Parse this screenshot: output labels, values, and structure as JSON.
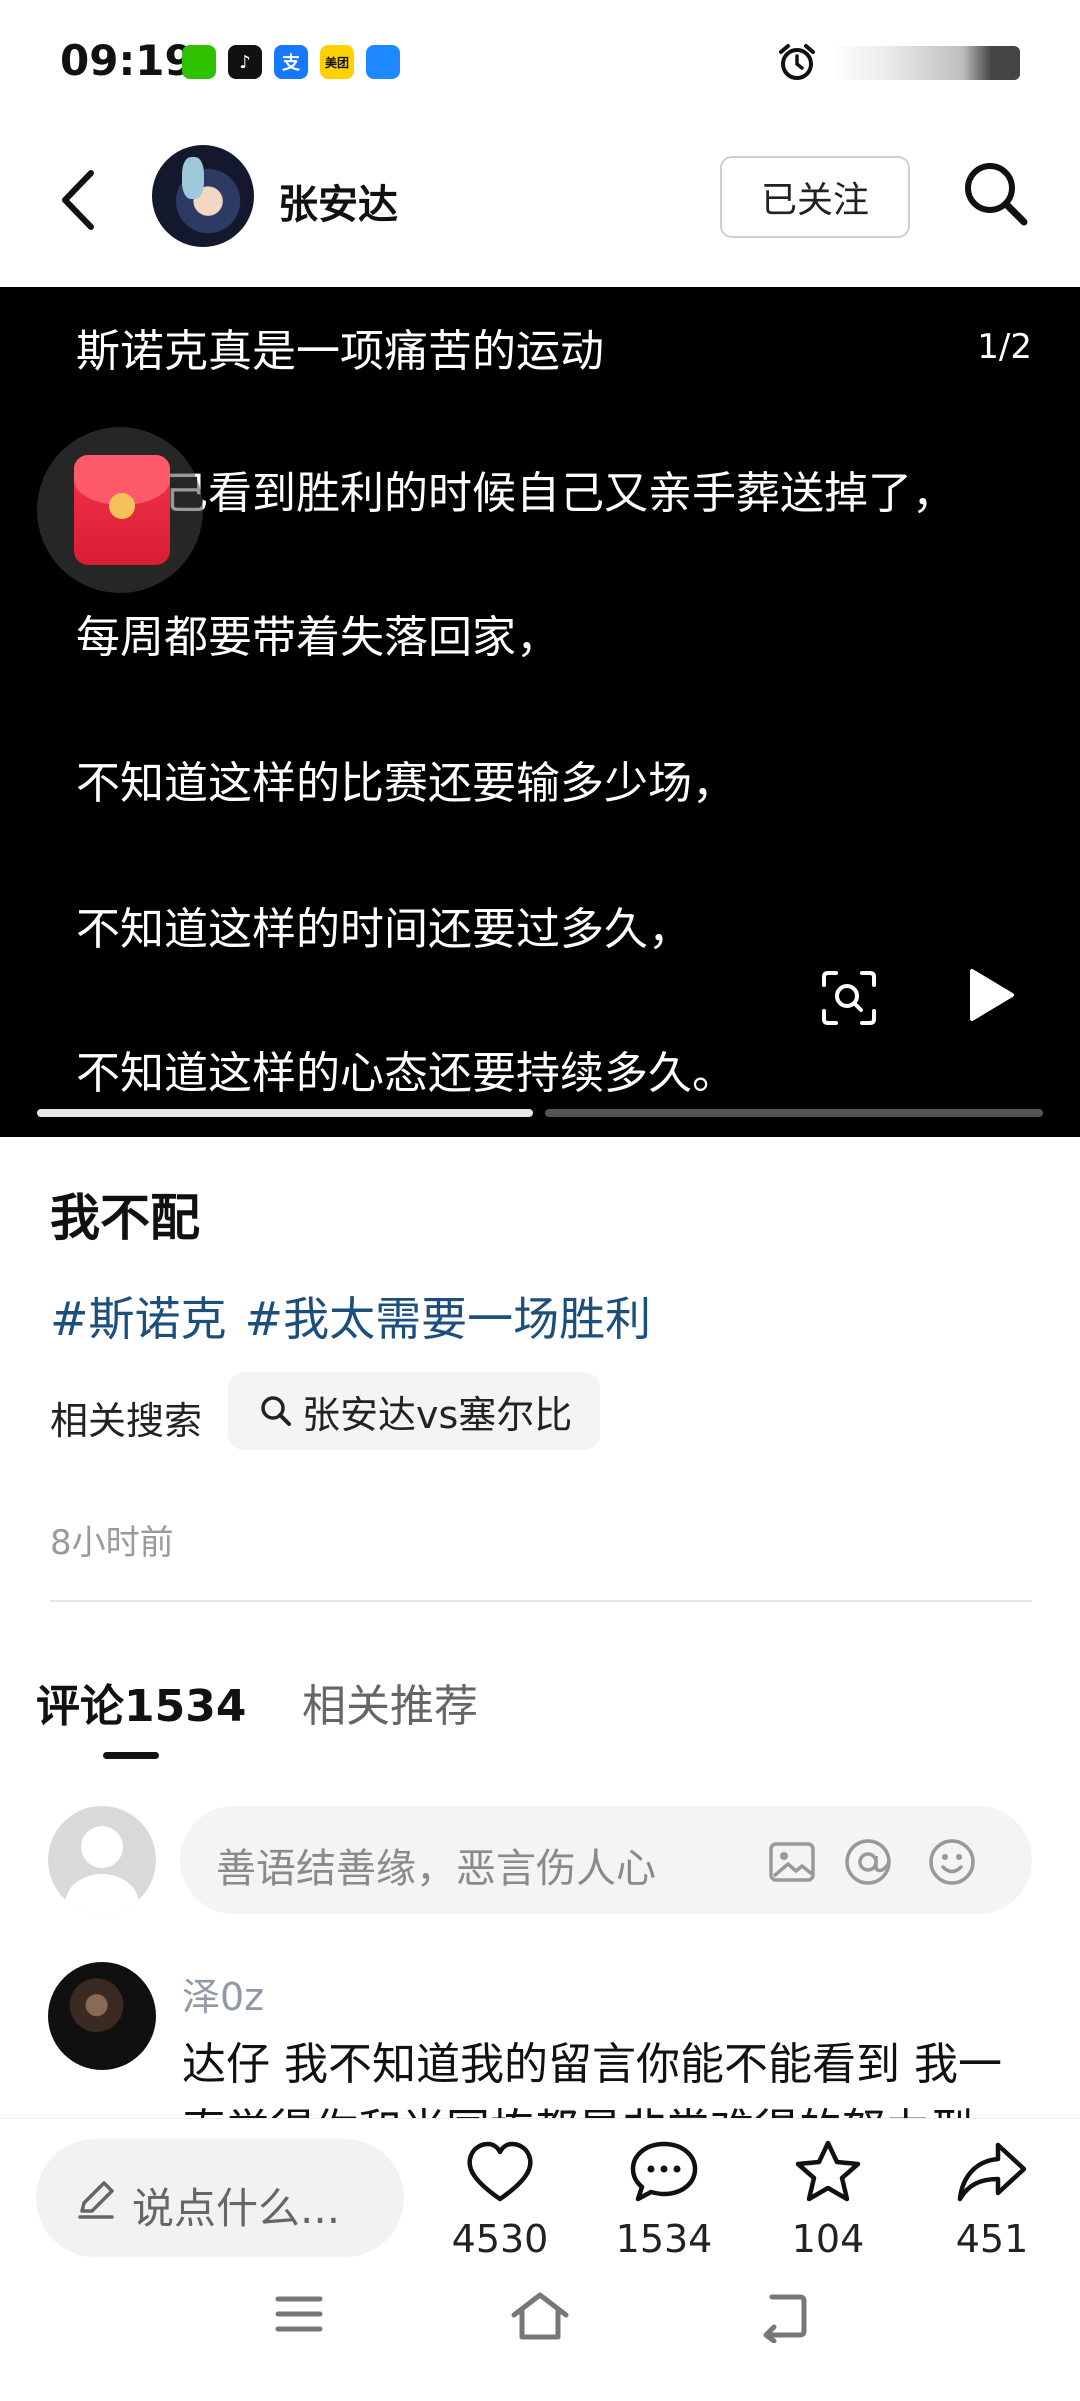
{
  "status_bar": {
    "time": "09:19",
    "apps": [
      {
        "name": "wechat-icon",
        "glyph": "",
        "color": "#2dc100"
      },
      {
        "name": "tiktok-icon",
        "glyph": "♪",
        "color": "#111111"
      },
      {
        "name": "alipay-icon",
        "glyph": "支",
        "color": "#1677ff"
      },
      {
        "name": "meituan-icon",
        "glyph": "美团",
        "color": "#ffd100"
      },
      {
        "name": "browser-icon",
        "glyph": "",
        "color": "#1e88ff"
      }
    ]
  },
  "header": {
    "username": "张安达",
    "follow_label": "已关注"
  },
  "media": {
    "page_indicator": "1/2",
    "lines": [
      "斯诺克真是一项痛苦的运动",
      "在自己看到胜利的时候自己又亲手葬送掉了，",
      "每周都要带着失落回家，",
      "不知道这样的比赛还要输多少场，",
      "不知道这样的时间还要过多久，",
      "不知道这样的心态还要持续多久。"
    ],
    "progress_segments": [
      {
        "filled": true
      },
      {
        "filled": false
      }
    ]
  },
  "post": {
    "title": "我不配",
    "hashtags": [
      "#斯诺克",
      "#我太需要一场胜利"
    ],
    "related_label": "相关搜索",
    "related_query": "张安达vs塞尔比",
    "time_ago": "8小时前"
  },
  "tabs": {
    "comments": "评论1534",
    "related": "相关推荐"
  },
  "comment_input": {
    "placeholder": "善语结善缘，恶言伤人心"
  },
  "comments": [
    {
      "user": "泽0z",
      "text": "达仔 我不知道我的留言你能不能看到 我一直觉得你和尚国栋都是非常难得的努力型"
    }
  ],
  "bottom_bar": {
    "say_placeholder": "说点什么...",
    "likes": "4530",
    "comments": "1534",
    "favorites": "104",
    "shares": "451"
  }
}
